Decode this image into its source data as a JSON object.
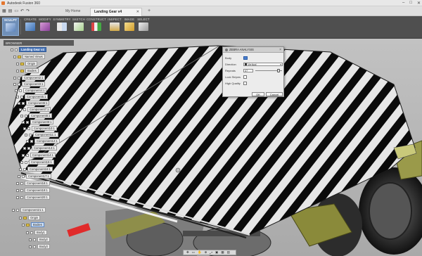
{
  "app": {
    "title": "Autodesk Fusion 360"
  },
  "tabs": [
    {
      "label": "My Home"
    },
    {
      "label": "Landing Gear v4"
    }
  ],
  "toolbar": {
    "groups": [
      {
        "label": "SCULPT",
        "icon": "sculpt-icon"
      },
      {
        "label": "CREATE",
        "icon": "create-icon"
      },
      {
        "label": "MODIFY",
        "icon": "modify-icon"
      },
      {
        "label": "SYMMETRY",
        "icon": "symmetry-icon"
      },
      {
        "label": "SKETCH",
        "icon": "sketch-icon"
      },
      {
        "label": "CONSTRUCT",
        "icon": "construct-icon"
      },
      {
        "label": "INSPECT",
        "icon": "inspect-icon"
      },
      {
        "label": "IMAGE",
        "icon": "image-icon"
      },
      {
        "label": "SELECT",
        "icon": "select-icon"
      }
    ]
  },
  "browser": {
    "title": "BROWSER",
    "root": "Landing Gear v4",
    "items": [
      "Named Views",
      "Origin",
      "Bodies",
      "Component2:1",
      "Component3:1",
      "Component4:1",
      "Component5:1",
      "Component6:1",
      "Component7:1",
      "Component8:1",
      "Component9:1",
      "Component10:1",
      "Component11:1",
      "Component12:1",
      "Component13:1",
      "Component14:1",
      "Component15:1",
      "Component16:1",
      "Component17:1",
      "Component18:1",
      "Component19:1",
      "Component20:1",
      "Component21:1",
      "Origin",
      "Bodies",
      "Body1",
      "Body2",
      "Body3"
    ]
  },
  "dialog": {
    "title": "ZEBRA ANALYSIS",
    "rows": {
      "body_label": "Body",
      "direction_label": "Direction",
      "direction_value": "Vertical",
      "repeats_label": "Repeats",
      "repeats_value": "47",
      "lock_label": "Lock Stripes",
      "hq_label": "High Quality"
    },
    "repeats_fraction": 0.9,
    "ok_label": "OK",
    "cancel_label": "Cancel"
  },
  "colors": {
    "selection_blue": "#4a7fd0",
    "stripe_black": "#0a0a0a",
    "stripe_white": "#e6e6e6",
    "root_highlight": "#4a76b8"
  }
}
